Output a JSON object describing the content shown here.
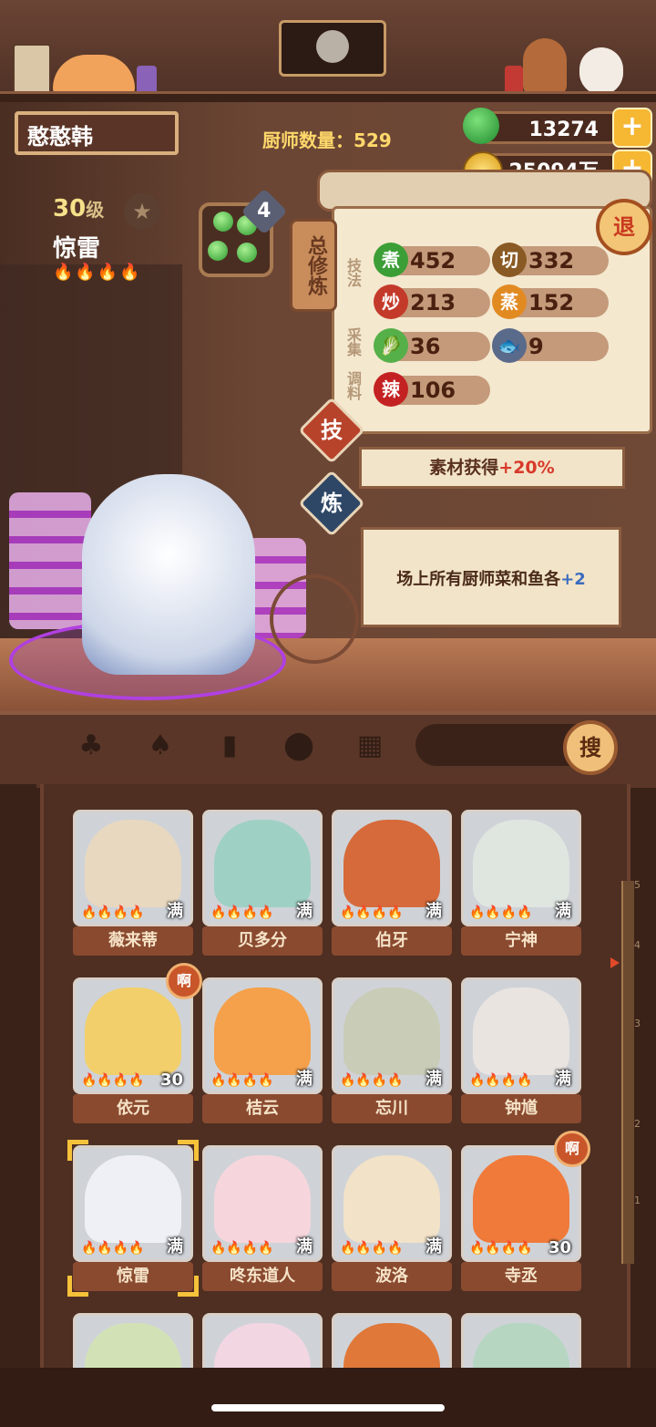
{
  "player": {
    "name": "憨憨韩"
  },
  "header": {
    "chef_count_label": "厨师数量：529"
  },
  "currency": {
    "jade": "13274",
    "coins": "25094万",
    "add": "+"
  },
  "chef": {
    "level": "30",
    "level_unit": "级",
    "title": "惊雷",
    "flames": "🔥🔥🔥🔥",
    "skill_slots": "4"
  },
  "panel": {
    "tab_label": "总修炼",
    "retreat": "退",
    "labels": {
      "technique": "技法",
      "gather": "采集",
      "seasoning": "调料"
    },
    "stats": [
      {
        "icon": "煮",
        "value": "452",
        "color": "#3c9e36"
      },
      {
        "icon": "切",
        "value": "332",
        "color": "#8a5a24"
      },
      {
        "icon": "炒",
        "value": "213",
        "color": "#c43a2a"
      },
      {
        "icon": "蒸",
        "value": "152",
        "color": "#e28a22"
      },
      {
        "icon": "🥬",
        "value": "36",
        "color": "#56b04a"
      },
      {
        "icon": "🐟",
        "value": "9",
        "color": "#5a6a8a"
      },
      {
        "icon": "辣",
        "value": "106",
        "color": "#c42222"
      }
    ],
    "tech_button": "技",
    "refine_button": "炼",
    "bonus_text": "素材获得",
    "bonus_value": "+20%",
    "effect_text": "场上所有厨师菜和鱼各",
    "effect_value": "+2"
  },
  "toolbar": {
    "icons": [
      "ingredient-icon",
      "meat-icon",
      "jar-icon",
      "location-icon",
      "map-icon"
    ],
    "search_button": "搜"
  },
  "scale": [
    "5",
    "4",
    "3",
    "2",
    "1"
  ],
  "chefs": [
    {
      "name": "薇来蒂",
      "badge": "满",
      "flames": "🔥🔥🔥🔥",
      "tone": "#e8d8c0"
    },
    {
      "name": "贝多分",
      "badge": "满",
      "flames": "🔥🔥🔥🔥",
      "tone": "#9fd0c4"
    },
    {
      "name": "伯牙",
      "badge": "满",
      "flames": "🔥🔥🔥🔥",
      "tone": "#d66a3a"
    },
    {
      "name": "宁神",
      "badge": "满",
      "flames": "🔥🔥🔥🔥",
      "tone": "#dfe6e0"
    },
    {
      "name": "依元",
      "badge": "30",
      "flames": "🔥🔥🔥🔥",
      "tone": "#f2cf6a",
      "tag": "啊"
    },
    {
      "name": "桔云",
      "badge": "满",
      "flames": "🔥🔥🔥🔥",
      "tone": "#f5a04a"
    },
    {
      "name": "忘川",
      "badge": "满",
      "flames": "🔥🔥🔥🔥",
      "tone": "#c9ccb6"
    },
    {
      "name": "钟馗",
      "badge": "满",
      "flames": "🔥🔥🔥🔥",
      "tone": "#e9e4e0"
    },
    {
      "name": "惊雷",
      "badge": "满",
      "flames": "🔥🔥🔥🔥",
      "tone": "#eef0f6",
      "selected": true
    },
    {
      "name": "咚东道人",
      "badge": "满",
      "flames": "🔥🔥🔥🔥",
      "tone": "#f6d6dc"
    },
    {
      "name": "波洛",
      "badge": "满",
      "flames": "🔥🔥🔥🔥",
      "tone": "#f2e2c8"
    },
    {
      "name": "寺丞",
      "badge": "30",
      "flames": "🔥🔥🔥🔥",
      "tone": "#f07a3a",
      "tag": "啊"
    },
    {
      "name": "",
      "badge": "",
      "flames": "",
      "tone": "#d2e2b6"
    },
    {
      "name": "",
      "badge": "",
      "flames": "",
      "tone": "#f2d6e2"
    },
    {
      "name": "",
      "badge": "",
      "flames": "",
      "tone": "#e0783a"
    },
    {
      "name": "",
      "badge": "",
      "flames": "",
      "tone": "#b6d6c2"
    }
  ]
}
